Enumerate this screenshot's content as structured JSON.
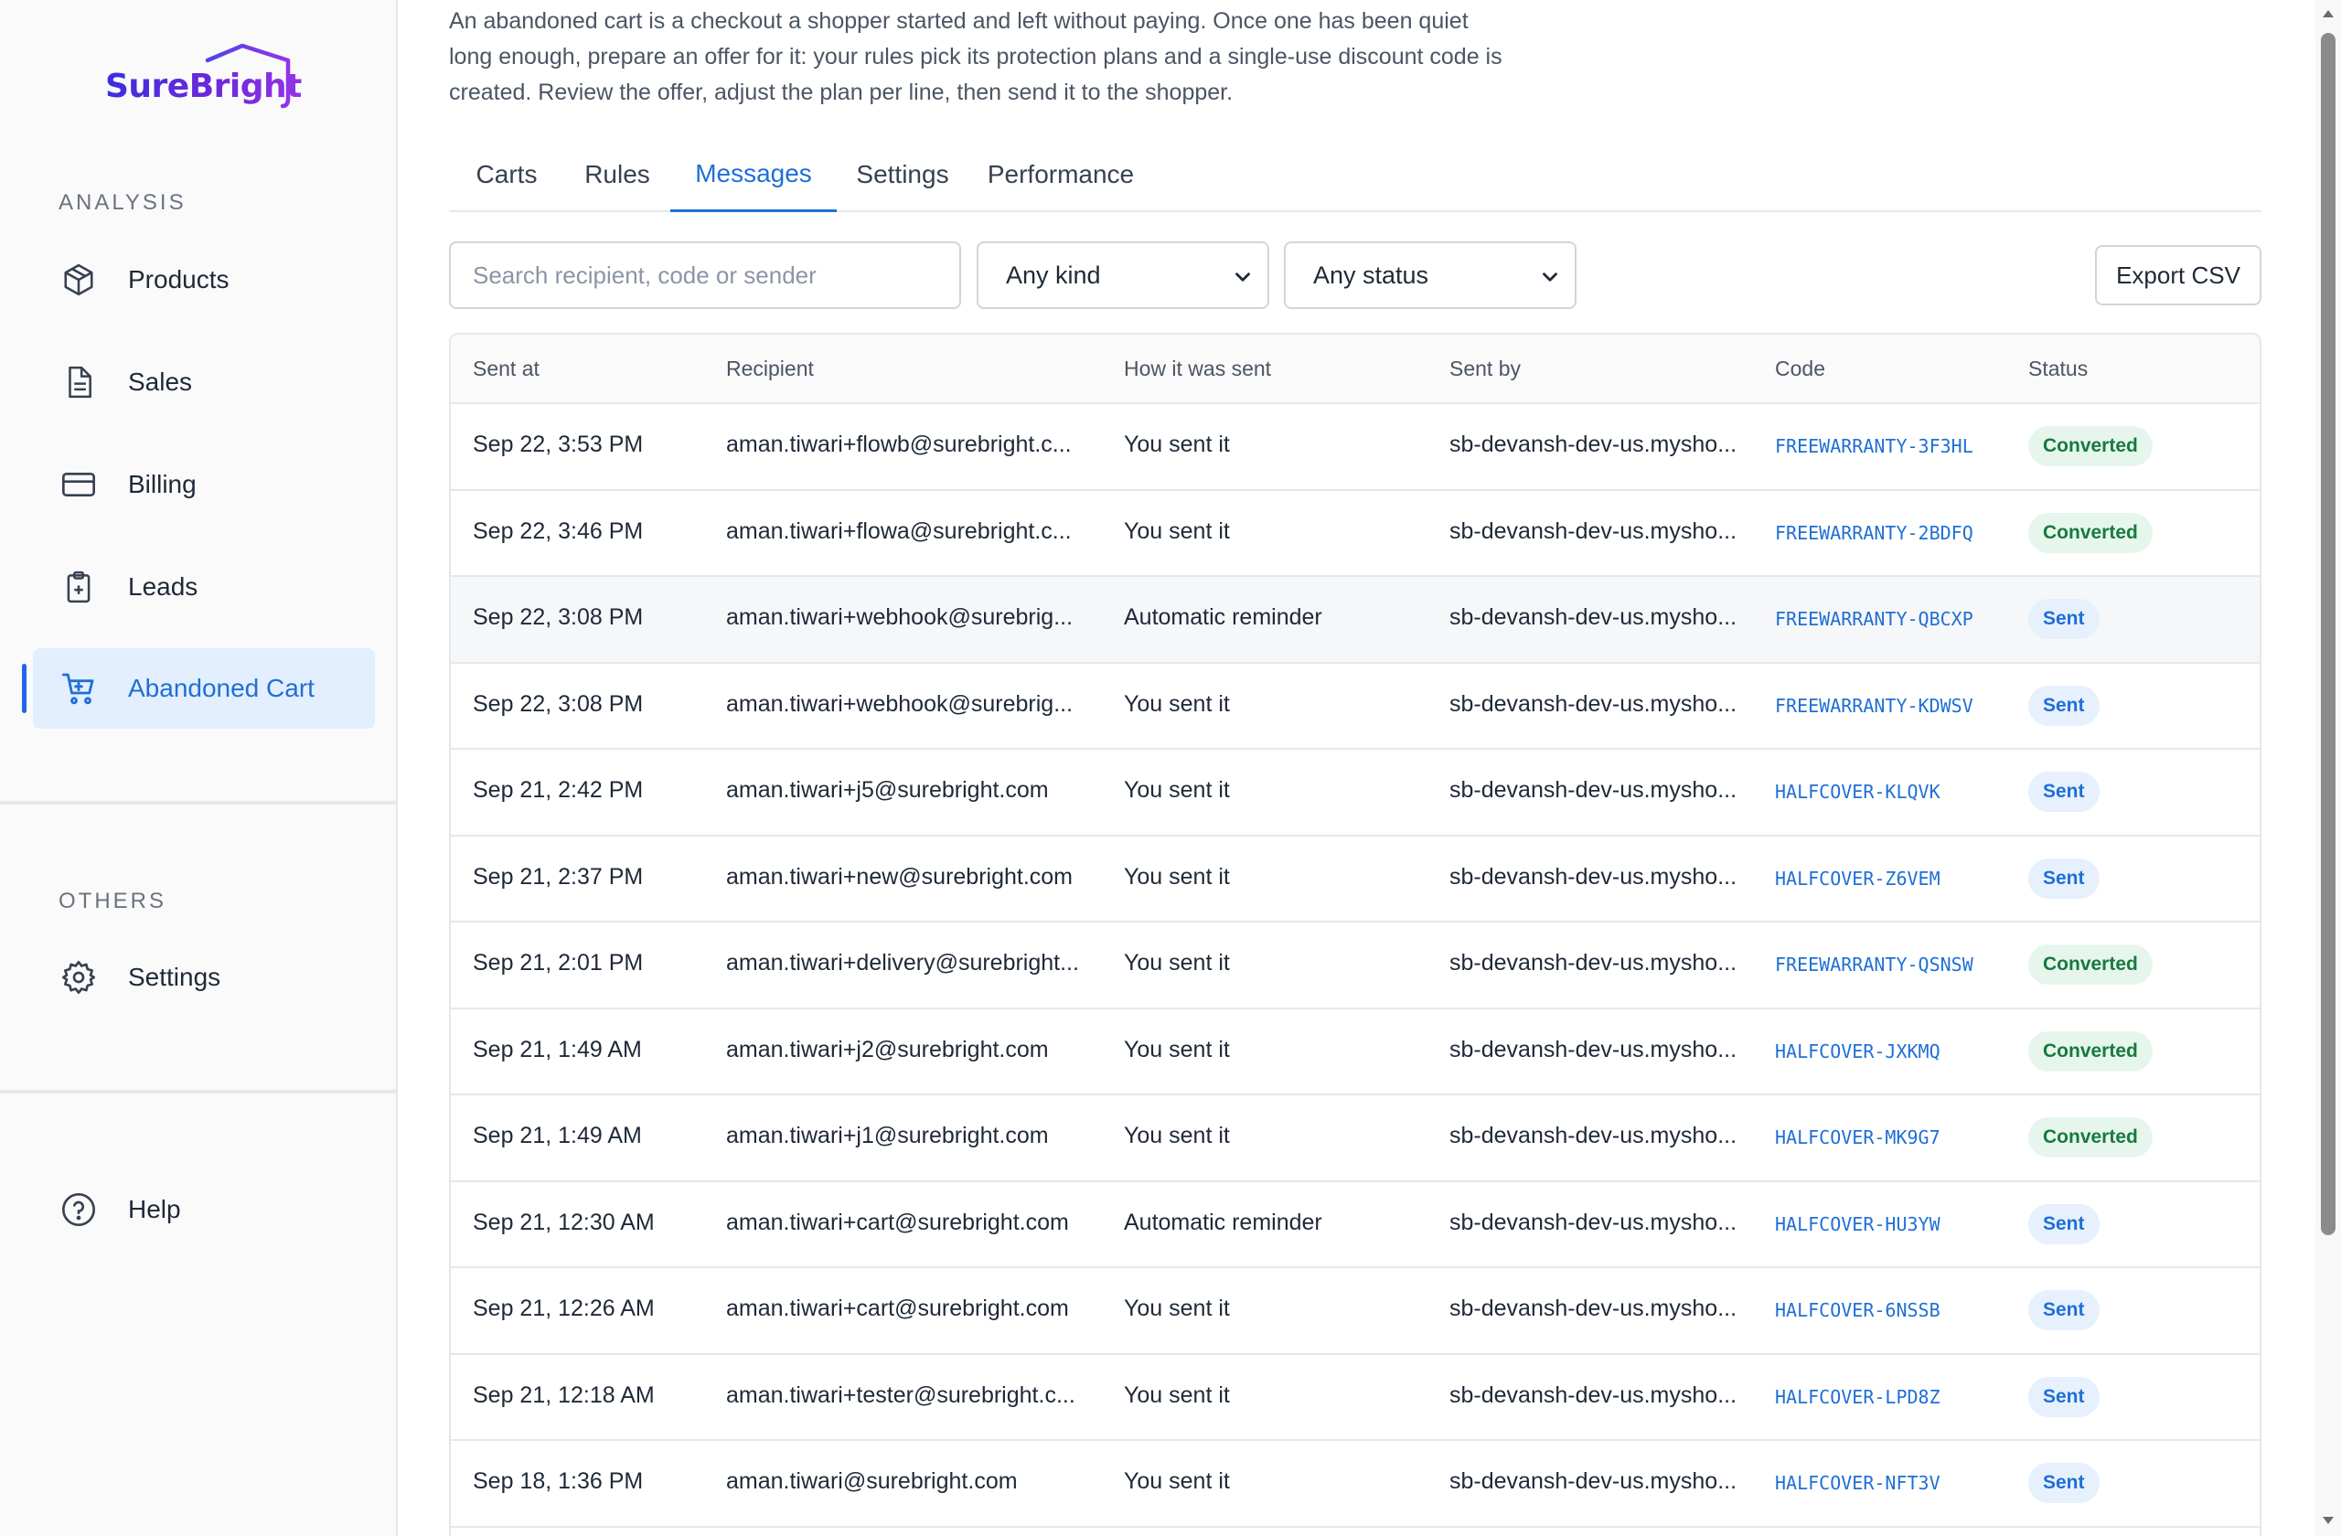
{
  "brand": {
    "name": "SureBright",
    "colors": {
      "accent": "#1f6fd6",
      "brand_purple": "#6d28d9"
    }
  },
  "sidebar": {
    "analysis_label": "ANALYSIS",
    "items": [
      {
        "label": "Products",
        "icon": "box-icon"
      },
      {
        "label": "Sales",
        "icon": "document-icon"
      },
      {
        "label": "Billing",
        "icon": "credit-card-icon"
      },
      {
        "label": "Leads",
        "icon": "clipboard-plus-icon"
      },
      {
        "label": "Abandoned Cart",
        "icon": "cart-icon",
        "active": true
      }
    ],
    "others_label": "OTHERS",
    "settings_label": "Settings",
    "help_label": "Help"
  },
  "intro": "An abandoned cart is a checkout a shopper started and left without paying. Once one has been quiet long enough, prepare an offer for it: your rules pick its protection plans and a single-use discount code is created. Review the offer, adjust the plan per line, then send it to the shopper.",
  "tabs": [
    "Carts",
    "Rules",
    "Messages",
    "Settings",
    "Performance"
  ],
  "active_tab": "Messages",
  "filters": {
    "search_placeholder": "Search recipient, code or sender",
    "kind": "Any kind",
    "status": "Any status",
    "export_label": "Export CSV"
  },
  "table": {
    "headers": [
      "Sent at",
      "Recipient",
      "How it was sent",
      "Sent by",
      "Code",
      "Status"
    ],
    "rows": [
      {
        "sent_at": "Sep 22, 3:53 PM",
        "recipient": "aman.tiwari+flowb@surebright.c...",
        "how": "You sent it",
        "by": "sb-devansh-dev-us.mysho...",
        "code": "FREEWARRANTY-3F3HL",
        "status": "Converted"
      },
      {
        "sent_at": "Sep 22, 3:46 PM",
        "recipient": "aman.tiwari+flowa@surebright.c...",
        "how": "You sent it",
        "by": "sb-devansh-dev-us.mysho...",
        "code": "FREEWARRANTY-2BDFQ",
        "status": "Converted"
      },
      {
        "sent_at": "Sep 22, 3:08 PM",
        "recipient": "aman.tiwari+webhook@surebrig...",
        "how": "Automatic reminder",
        "by": "sb-devansh-dev-us.mysho...",
        "code": "FREEWARRANTY-QBCXP",
        "status": "Sent"
      },
      {
        "sent_at": "Sep 22, 3:08 PM",
        "recipient": "aman.tiwari+webhook@surebrig...",
        "how": "You sent it",
        "by": "sb-devansh-dev-us.mysho...",
        "code": "FREEWARRANTY-KDWSV",
        "status": "Sent"
      },
      {
        "sent_at": "Sep 21, 2:42 PM",
        "recipient": "aman.tiwari+j5@surebright.com",
        "how": "You sent it",
        "by": "sb-devansh-dev-us.mysho...",
        "code": "HALFCOVER-KLQVK",
        "status": "Sent"
      },
      {
        "sent_at": "Sep 21, 2:37 PM",
        "recipient": "aman.tiwari+new@surebright.com",
        "how": "You sent it",
        "by": "sb-devansh-dev-us.mysho...",
        "code": "HALFCOVER-Z6VEM",
        "status": "Sent"
      },
      {
        "sent_at": "Sep 21, 2:01 PM",
        "recipient": "aman.tiwari+delivery@surebright...",
        "how": "You sent it",
        "by": "sb-devansh-dev-us.mysho...",
        "code": "FREEWARRANTY-QSNSW",
        "status": "Converted"
      },
      {
        "sent_at": "Sep 21, 1:49 AM",
        "recipient": "aman.tiwari+j2@surebright.com",
        "how": "You sent it",
        "by": "sb-devansh-dev-us.mysho...",
        "code": "HALFCOVER-JXKMQ",
        "status": "Converted"
      },
      {
        "sent_at": "Sep 21, 1:49 AM",
        "recipient": "aman.tiwari+j1@surebright.com",
        "how": "You sent it",
        "by": "sb-devansh-dev-us.mysho...",
        "code": "HALFCOVER-MK9G7",
        "status": "Converted"
      },
      {
        "sent_at": "Sep 21, 12:30 AM",
        "recipient": "aman.tiwari+cart@surebright.com",
        "how": "Automatic reminder",
        "by": "sb-devansh-dev-us.mysho...",
        "code": "HALFCOVER-HU3YW",
        "status": "Sent"
      },
      {
        "sent_at": "Sep 21, 12:26 AM",
        "recipient": "aman.tiwari+cart@surebright.com",
        "how": "You sent it",
        "by": "sb-devansh-dev-us.mysho...",
        "code": "HALFCOVER-6NSSB",
        "status": "Sent"
      },
      {
        "sent_at": "Sep 21, 12:18 AM",
        "recipient": "aman.tiwari+tester@surebright.c...",
        "how": "You sent it",
        "by": "sb-devansh-dev-us.mysho...",
        "code": "HALFCOVER-LPD8Z",
        "status": "Sent"
      },
      {
        "sent_at": "Sep 18, 1:36 PM",
        "recipient": "aman.tiwari@surebright.com",
        "how": "You sent it",
        "by": "sb-devansh-dev-us.mysho...",
        "code": "HALFCOVER-NFT3V",
        "status": "Sent"
      }
    ]
  }
}
